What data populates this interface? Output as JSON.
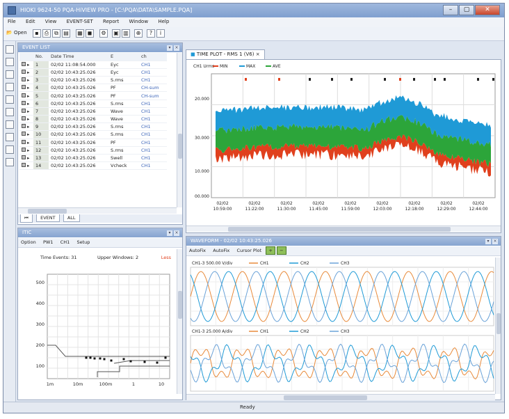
{
  "window": {
    "title": "HIOKI 9624-50 PQA-HiVIEW PRO - [C:\\PQA\\DATA\\SAMPLE.PQA]"
  },
  "menu": [
    "File",
    "Edit",
    "View",
    "EVENT-SET",
    "Report",
    "Window",
    "Help"
  ],
  "toolbar": {
    "open_label": "Open"
  },
  "event_panel": {
    "title": "EVENT LIST",
    "columns": [
      "",
      "No.",
      "Date Time",
      "E",
      "ch"
    ],
    "rows": [
      {
        "no": "1",
        "time": "02/02 11:08:54.000",
        "event": "Eyc",
        "ch": "CH1"
      },
      {
        "no": "2",
        "time": "02/02 10:43:25.026",
        "event": "Eyc",
        "ch": "CH1"
      },
      {
        "no": "3",
        "time": "02/02 10:43:25.026",
        "event": "S.rms",
        "ch": "CH1"
      },
      {
        "no": "4",
        "time": "02/02 10:43:25.026",
        "event": "PF",
        "ch": "CH-sum"
      },
      {
        "no": "5",
        "time": "02/02 10:43:25.026",
        "event": "PF",
        "ch": "CH-sum"
      },
      {
        "no": "6",
        "time": "02/02 10:43:25.026",
        "event": "S.rms",
        "ch": "CH1"
      },
      {
        "no": "7",
        "time": "02/02 10:43:25.026",
        "event": "Wave",
        "ch": "CH1"
      },
      {
        "no": "8",
        "time": "02/02 10:43:25.026",
        "event": "Wave",
        "ch": "CH1"
      },
      {
        "no": "9",
        "time": "02/02 10:43:25.026",
        "event": "S.rms",
        "ch": "CH1"
      },
      {
        "no": "10",
        "time": "02/02 10:43:25.026",
        "event": "S.rms",
        "ch": "CH1"
      },
      {
        "no": "11",
        "time": "02/02 10:43:25.026",
        "event": "PF",
        "ch": "CH1"
      },
      {
        "no": "12",
        "time": "02/02 10:43:25.026",
        "event": "S.rms",
        "ch": "CH1"
      },
      {
        "no": "13",
        "time": "02/02 10:43:25.026",
        "event": "Swell",
        "ch": "CH1"
      },
      {
        "no": "14",
        "time": "02/02 10:43:25.026",
        "event": "Vcheck",
        "ch": "CH1"
      }
    ],
    "tabs": [
      "EVENT",
      "ALL"
    ]
  },
  "trend_panel": {
    "tab_label": "TIME PLOT - RMS 1 (V6)",
    "legend": [
      "CH1 Urms",
      "MIN",
      "MAX",
      "AVE"
    ],
    "y_ticks": [
      "20.000",
      "30.000",
      "10.000",
      "00.000"
    ],
    "x_ticks": [
      [
        "02/02",
        "10:59:00"
      ],
      [
        "02/02",
        "11:22:00"
      ],
      [
        "02/02",
        "11:30:00"
      ],
      [
        "02/02",
        "11:45:00"
      ],
      [
        "02/02",
        "11:59:00"
      ],
      [
        "02/02",
        "12:03:00"
      ],
      [
        "02/02",
        "12:18:00"
      ],
      [
        "02/02",
        "12:29:00"
      ],
      [
        "02/02",
        "12:44:00"
      ]
    ]
  },
  "itic_panel": {
    "title": "ITIC",
    "toolbar": [
      "Option",
      "PW1",
      "CH1",
      "Setup"
    ],
    "header_left": "Time Events: 31",
    "header_right": "Upper Windows: 2",
    "header_end": "Less",
    "y_ticks": [
      "500",
      "400",
      "300",
      "200",
      "100"
    ],
    "x_ticks": [
      "1m",
      "10m",
      "100m",
      "1",
      "10"
    ]
  },
  "wave_panel": {
    "title": "WAVEFORM - 02/02 10:43:25.026",
    "toolbar": [
      "AutoFix",
      "AutoFix",
      "Cursor Plot"
    ],
    "upper_legend": [
      "CH1-3 500.00 V/div",
      "CH1",
      "CH2",
      "CH3"
    ],
    "lower_legend": [
      "CH1-3 25.000 A/div",
      "CH1",
      "CH2",
      "CH3"
    ]
  },
  "status": {
    "text": "Ready"
  },
  "colors": {
    "ch_blue": "#1f9ad6",
    "ch_green": "#2ca53a",
    "ch_red": "#e0401d",
    "ch_orange": "#e88a3a",
    "title_blue": "#86a4d0"
  }
}
